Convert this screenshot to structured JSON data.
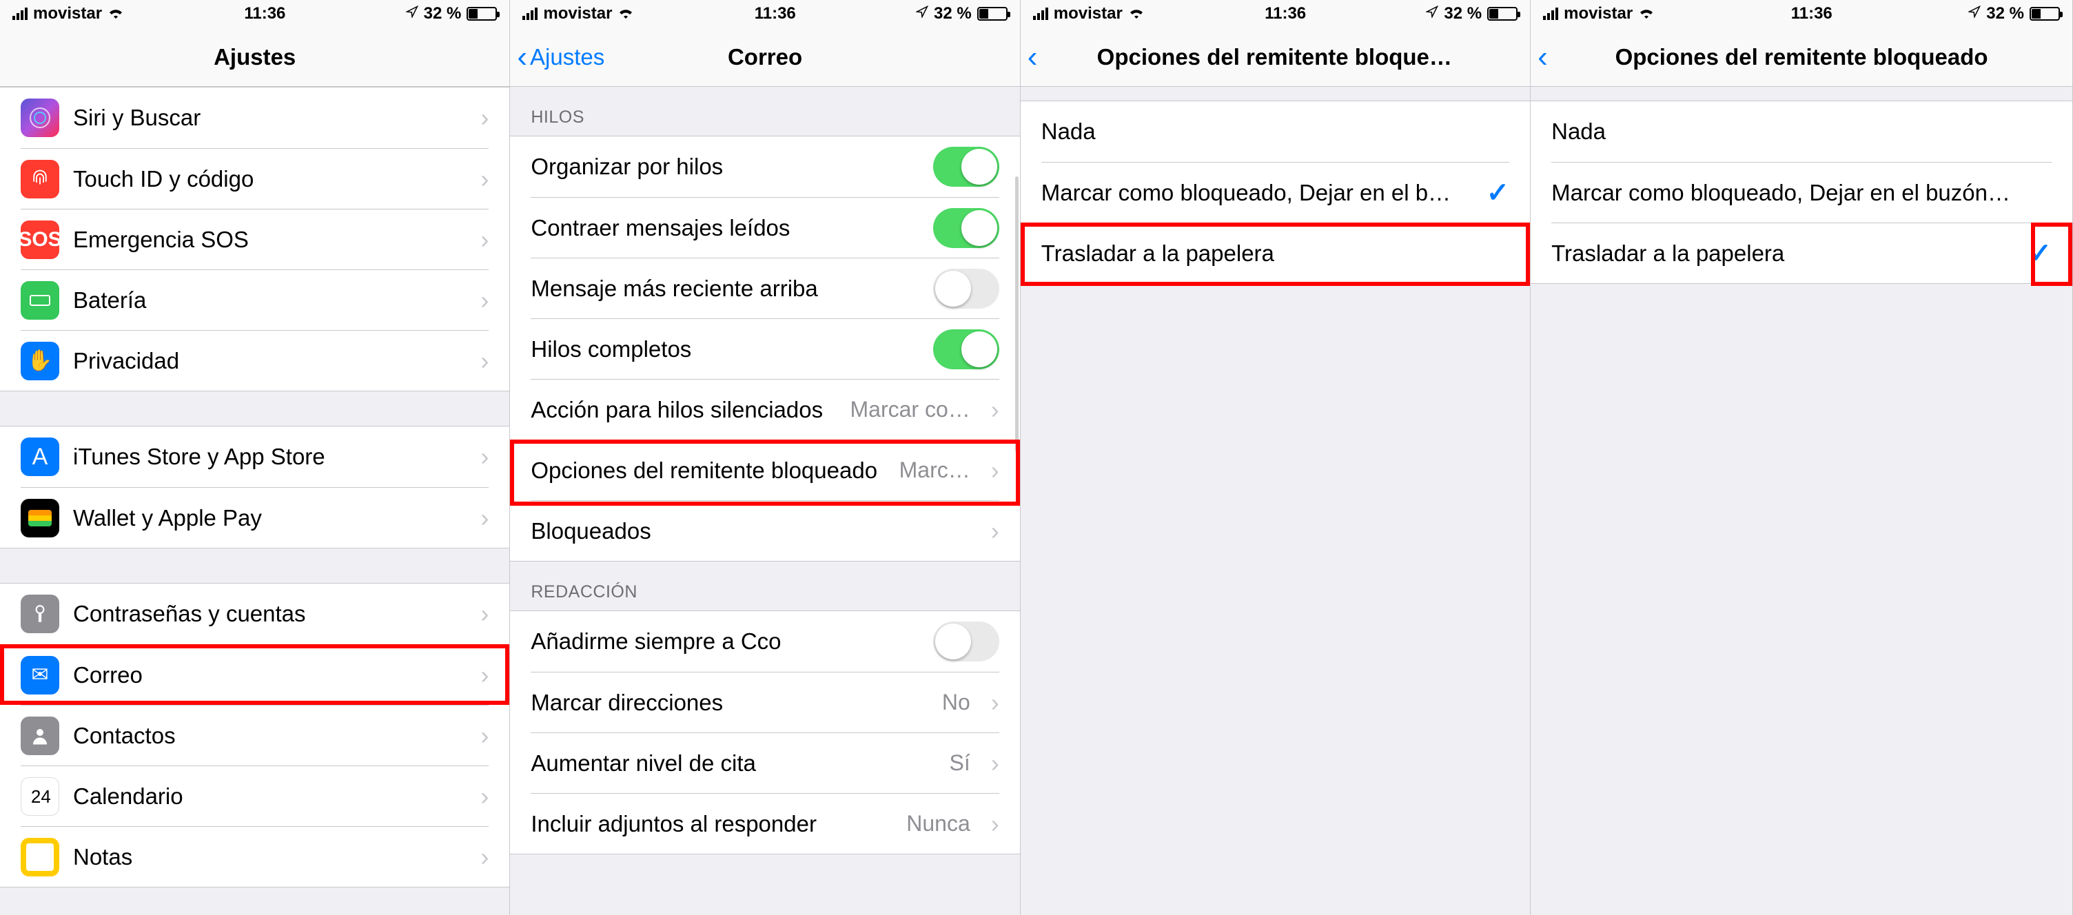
{
  "status": {
    "carrier": "movistar",
    "time": "11:36",
    "battery_pct": "32 %"
  },
  "panel1": {
    "title": "Ajustes",
    "rows_g1": [
      {
        "icon": "ic-siri",
        "label": "Siri y Buscar"
      },
      {
        "icon": "ic-touch",
        "label": "Touch ID y código"
      },
      {
        "icon": "ic-sos",
        "label": "Emergencia SOS",
        "icon_text": "SOS"
      },
      {
        "icon": "ic-battery",
        "label": "Batería"
      },
      {
        "icon": "ic-privacy",
        "label": "Privacidad"
      }
    ],
    "rows_g2": [
      {
        "icon": "ic-itunes",
        "label": "iTunes Store y App Store"
      },
      {
        "icon": "ic-wallet",
        "label": "Wallet y Apple Pay"
      }
    ],
    "rows_g3": [
      {
        "icon": "ic-passwords",
        "label": "Contraseñas y cuentas"
      },
      {
        "icon": "ic-mail",
        "label": "Correo"
      },
      {
        "icon": "ic-contacts",
        "label": "Contactos"
      },
      {
        "icon": "ic-calendar",
        "label": "Calendario"
      },
      {
        "icon": "ic-notes",
        "label": "Notas"
      }
    ]
  },
  "panel2": {
    "back": "Ajustes",
    "title": "Correo",
    "section1": "Hilos",
    "rows1": [
      {
        "label": "Organizar por hilos",
        "switch": true
      },
      {
        "label": "Contraer mensajes leídos",
        "switch": true
      },
      {
        "label": "Mensaje más reciente arriba",
        "switch": false
      },
      {
        "label": "Hilos completos",
        "switch": true
      },
      {
        "label": "Acción para hilos silenciados",
        "detail": "Marcar co…",
        "nav": true
      },
      {
        "label": "Opciones del remitente bloqueado",
        "detail": "Marc…",
        "nav": true
      },
      {
        "label": "Bloqueados",
        "nav": true
      }
    ],
    "section2": "Redacción",
    "rows2": [
      {
        "label": "Añadirme siempre a Cco",
        "switch": false
      },
      {
        "label": "Marcar direcciones",
        "detail": "No",
        "nav": true
      },
      {
        "label": "Aumentar nivel de cita",
        "detail": "Sí",
        "nav": true
      },
      {
        "label": "Incluir adjuntos al responder",
        "detail": "Nunca",
        "nav": true
      }
    ]
  },
  "panel3": {
    "title": "Opciones del remitente bloqueado",
    "rows": [
      {
        "label": "Nada",
        "checked": false
      },
      {
        "label": "Marcar como bloqueado, Dejar en el b…",
        "checked": true
      },
      {
        "label": "Trasladar a la papelera",
        "checked": false
      }
    ]
  },
  "panel4": {
    "title": "Opciones del remitente bloqueado",
    "rows": [
      {
        "label": "Nada",
        "checked": false
      },
      {
        "label": "Marcar como bloqueado, Dejar en el buzón…",
        "checked": false
      },
      {
        "label": "Trasladar a la papelera",
        "checked": true
      }
    ]
  }
}
